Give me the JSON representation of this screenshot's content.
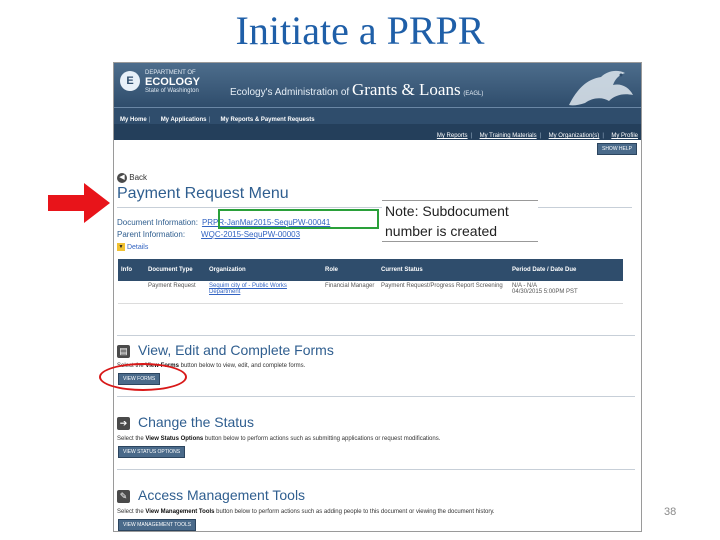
{
  "slide": {
    "title": "Initiate a PRPR",
    "note": "Note: Subdocument number is created",
    "page_number": "38",
    "colors": {
      "title": "#1f5fa8",
      "highlight_green": "#2aa03a",
      "highlight_red": "#d81818",
      "arrow_red": "#e8141a"
    }
  },
  "app": {
    "agency_small": "DEPARTMENT OF",
    "agency_name": "ECOLOGY",
    "agency_state": "State of Washington",
    "system_prefix": "Ecology's Administration of",
    "system_name": "Grants & Loans",
    "system_abbr": "(EAGL)",
    "nav_primary": [
      "My Home",
      "My Applications",
      "My Reports & Payment Requests"
    ],
    "nav_secondary": [
      "My Reports",
      "My Training Materials",
      "My Organization(s)",
      "My Profile"
    ],
    "show_help": "SHOW HELP",
    "back": "Back",
    "page_title": "Payment Request Menu",
    "document_info_label": "Document Information:",
    "document_info_value": "PRPR-JanMar2015-SequPW-00041",
    "parent_info_label": "Parent Information:",
    "parent_info_value": "WQC-2015-SequPW-00003",
    "details_label": "Details",
    "table": {
      "headers": [
        "Info",
        "Document Type",
        "Organization",
        "Role",
        "Current Status",
        "Period Date / Date Due"
      ],
      "row": {
        "doc_type": "Payment Request",
        "organization": "Sequim city of - Public Works Department",
        "role": "Financial Manager",
        "status": "Payment Request/Progress Report Screening",
        "period": "N/A - N/A",
        "due": "04/30/2015 5:00PM PST"
      }
    },
    "sections": [
      {
        "title": "View, Edit and Complete Forms",
        "pre": "Select the ",
        "bold": "View Forms",
        "post": " button below to view, edit, and complete forms.",
        "button": "VIEW FORMS"
      },
      {
        "title": "Change the Status",
        "pre": "Select the ",
        "bold": "View Status Options",
        "post": " button below to perform actions such as submitting applications or request modifications.",
        "button": "VIEW STATUS OPTIONS"
      },
      {
        "title": "Access Management Tools",
        "pre": "Select the ",
        "bold": "View Management Tools",
        "post": " button below to perform actions such as adding people to this document or viewing the document history.",
        "button": "VIEW MANAGEMENT TOOLS"
      }
    ]
  }
}
